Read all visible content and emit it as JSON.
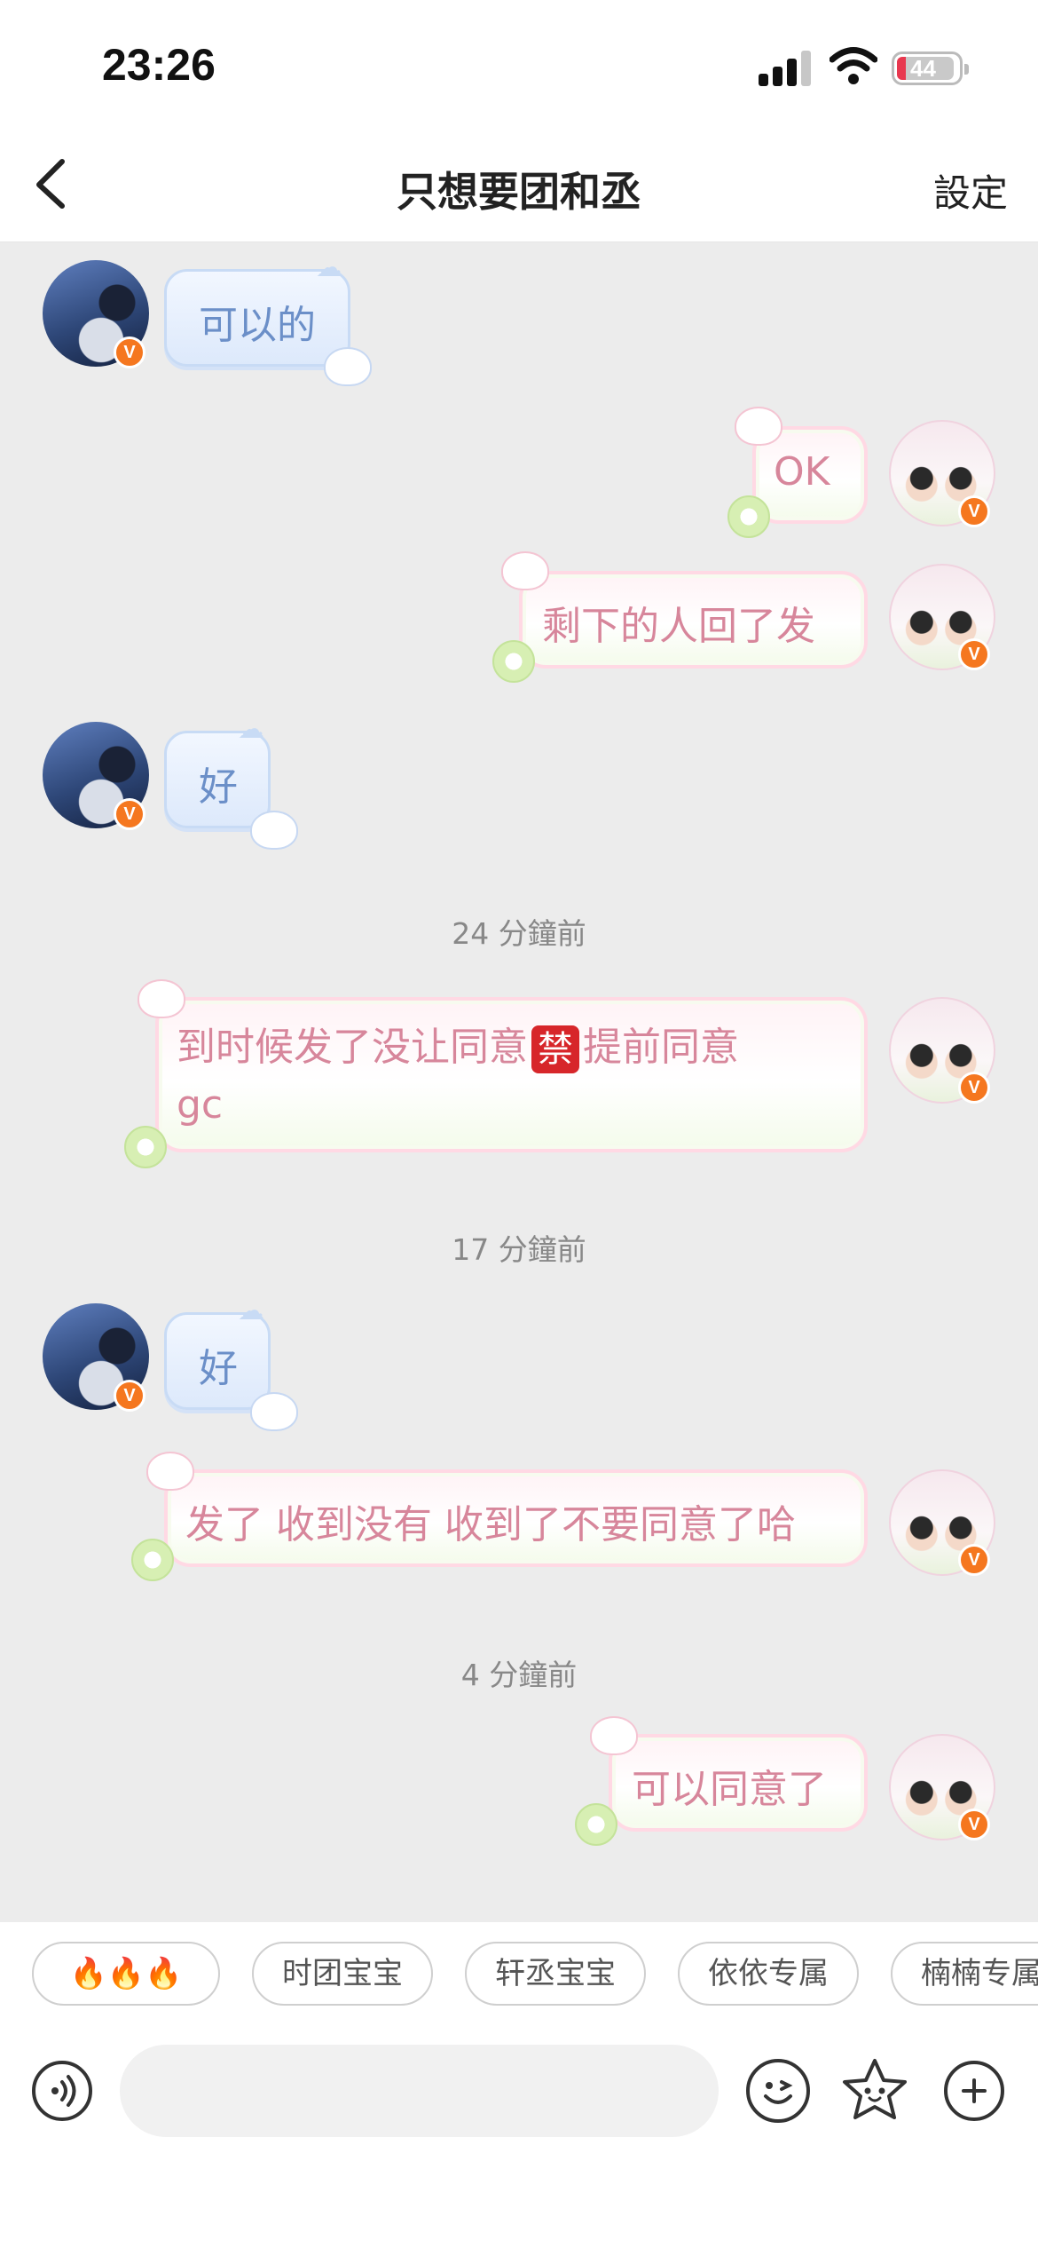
{
  "status_bar": {
    "time": "23:26",
    "battery_level": "44"
  },
  "header": {
    "title": "只想要团和丞",
    "settings_label": "設定"
  },
  "messages": [
    {
      "side": "left",
      "text": "可以的"
    },
    {
      "side": "right",
      "text": "OK"
    },
    {
      "side": "right",
      "text": "剩下的人回了发"
    },
    {
      "side": "left",
      "text": "好"
    },
    {
      "timestamp": "24 分鐘前"
    },
    {
      "side": "right",
      "text_before": "到时候发了没让同意",
      "emoji": "禁",
      "text_after": "提前同意",
      "text_line2": "gc"
    },
    {
      "timestamp": "17 分鐘前"
    },
    {
      "side": "left",
      "text": "好"
    },
    {
      "side": "right",
      "text": "发了 收到没有 收到了不要同意了哈"
    },
    {
      "timestamp": "4 分鐘前"
    },
    {
      "side": "right",
      "text": "可以同意了"
    }
  ],
  "badge_letter": "V",
  "quick_tags": [
    "🔥🔥🔥",
    "时团宝宝",
    "轩丞宝宝",
    "依依专属",
    "楠楠专属"
  ],
  "icons": {
    "back": "chevron-left-icon",
    "voice": "voice-icon",
    "emoji": "emoji-icon",
    "sticker": "star-sticker-icon",
    "add": "plus-icon"
  },
  "colors": {
    "chat_bg": "#ececec",
    "incoming_text": "#6b8fc8",
    "outgoing_text": "#d7869b",
    "verified_badge": "#f5771f"
  }
}
